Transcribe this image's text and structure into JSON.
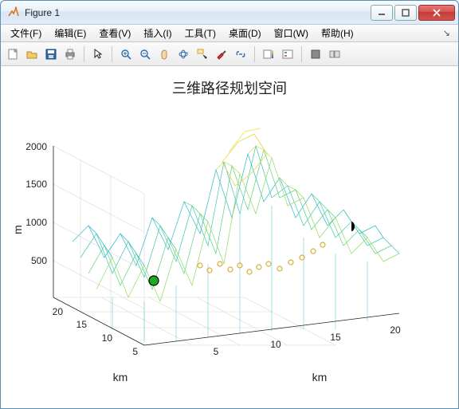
{
  "window": {
    "title": "Figure 1"
  },
  "menubar": {
    "items": [
      "文件(F)",
      "编辑(E)",
      "查看(V)",
      "插入(I)",
      "工具(T)",
      "桌面(D)",
      "窗口(W)",
      "帮助(H)"
    ]
  },
  "toolbar": {
    "new": "New Figure",
    "open": "Open",
    "save": "Save",
    "print": "Print",
    "pointer": "Edit Plot",
    "zoom_in": "Zoom In",
    "zoom_out": "Zoom Out",
    "pan": "Pan",
    "rotate": "Rotate 3D",
    "datacursor": "Data Cursor",
    "brush": "Brush",
    "link": "Link Plot",
    "colorbar": "Insert Colorbar",
    "legend": "Insert Legend",
    "hide": "Hide Plot Tools",
    "show": "Show Plot Tools"
  },
  "plot": {
    "title": "三维路径规划空间",
    "xlabel": "km",
    "ylabel": "km",
    "zlabel": "m",
    "xticks": [
      "5",
      "10",
      "15",
      "20"
    ],
    "yticks": [
      "5",
      "10",
      "15",
      "20"
    ],
    "zticks": [
      "500",
      "1000",
      "1500",
      "2000"
    ]
  },
  "chart_data": {
    "type": "surface-mesh",
    "title": "三维路径规划空间",
    "xlabel": "km",
    "ylabel": "km",
    "zlabel": "m",
    "xrange": [
      0,
      21
    ],
    "yrange": [
      0,
      21
    ],
    "zrange": [
      0,
      2000
    ],
    "note": "3D terrain mesh with elevation 0–2000 m over a 21×21 km grid; colormap cyan→green→yellow by height; green marker near start, scattered yellow circle path markers across mid-field."
  }
}
